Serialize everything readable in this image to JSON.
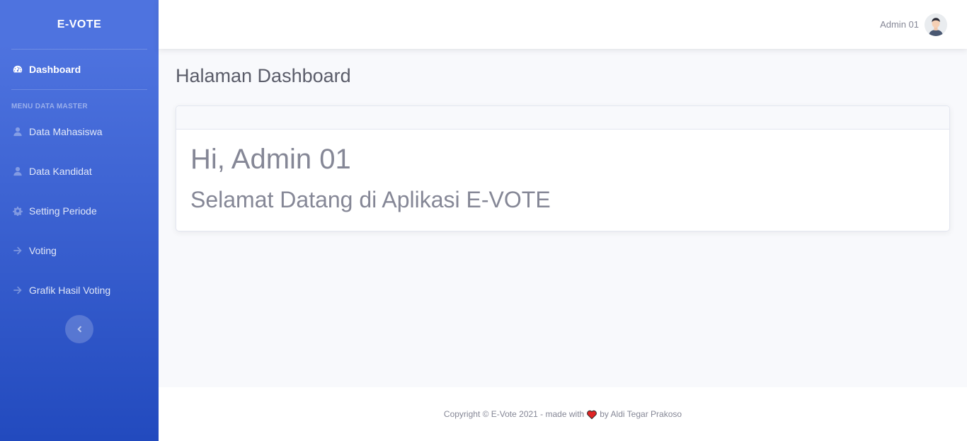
{
  "sidebar": {
    "brand": "E-VOTE",
    "dashboard": {
      "label": "Dashboard",
      "icon": "tachometer-icon"
    },
    "section_heading": "MENU DATA MASTER",
    "items": [
      {
        "label": "Data Mahasiswa",
        "icon": "user-icon"
      },
      {
        "label": "Data Kandidat",
        "icon": "user-icon"
      },
      {
        "label": "Setting Periode",
        "icon": "gear-icon"
      },
      {
        "label": "Voting",
        "icon": "arrow-right-icon"
      },
      {
        "label": "Grafik Hasil Voting",
        "icon": "arrow-right-icon"
      }
    ],
    "toggle_icon": "chevron-left-icon"
  },
  "topbar": {
    "user_name": "Admin 01",
    "avatar_icon": "avatar-icon"
  },
  "main": {
    "page_title": "Halaman Dashboard",
    "card": {
      "greeting": "Hi, Admin 01",
      "welcome": "Selamat Datang di Aplikasi E-VOTE"
    }
  },
  "footer": {
    "prefix": "Copyright © E-Vote 2021 - made with",
    "suffix": "by Aldi Tegar Prakoso",
    "heart_icon": "heart-icon"
  },
  "colors": {
    "sidebar_start": "#4e73df",
    "sidebar_end": "#224abe",
    "background": "#f8f9fc",
    "text_muted": "#858796",
    "heart": "#e02424"
  }
}
